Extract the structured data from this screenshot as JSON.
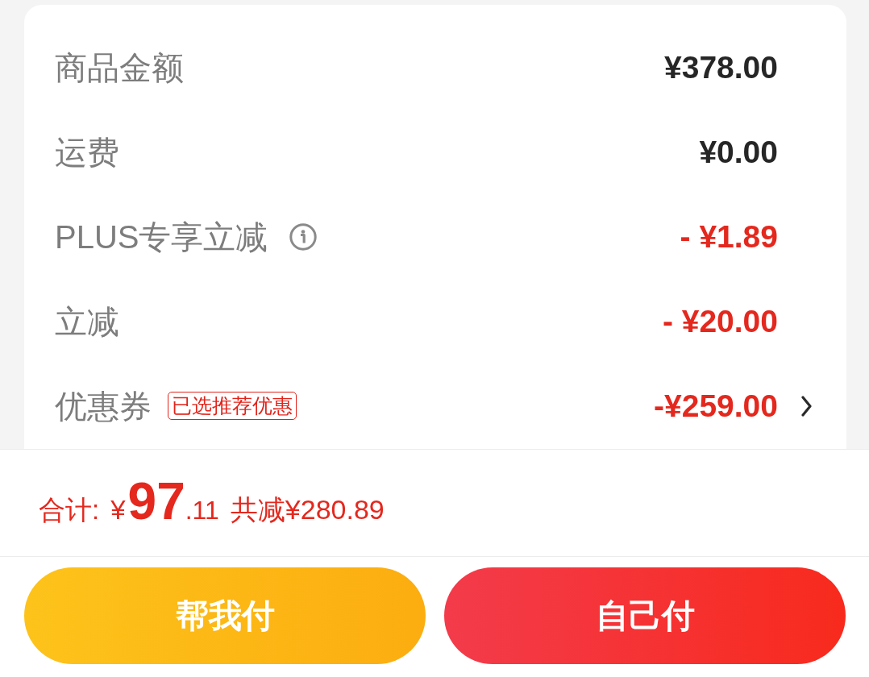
{
  "summary": {
    "rows": [
      {
        "kind": "charge",
        "label": "商品金额",
        "value": "¥378.00"
      },
      {
        "kind": "charge",
        "label": "运费",
        "value": "¥0.00"
      },
      {
        "kind": "member",
        "label": "PLUS专享立减",
        "value": "- ¥1.89"
      },
      {
        "kind": "discount",
        "label": "立减",
        "value": "- ¥20.00"
      },
      {
        "kind": "coupon",
        "label": "优惠券",
        "tag": "已选推荐优惠",
        "value": "-¥259.00"
      }
    ]
  },
  "total": {
    "label": "合计:",
    "currency": "¥",
    "integer": "97",
    "fraction": ".11",
    "saving": "共减¥280.89"
  },
  "buttons": [
    {
      "kind": "secondary",
      "label": "帮我付"
    },
    {
      "kind": "primary",
      "label": "自己付"
    }
  ]
}
